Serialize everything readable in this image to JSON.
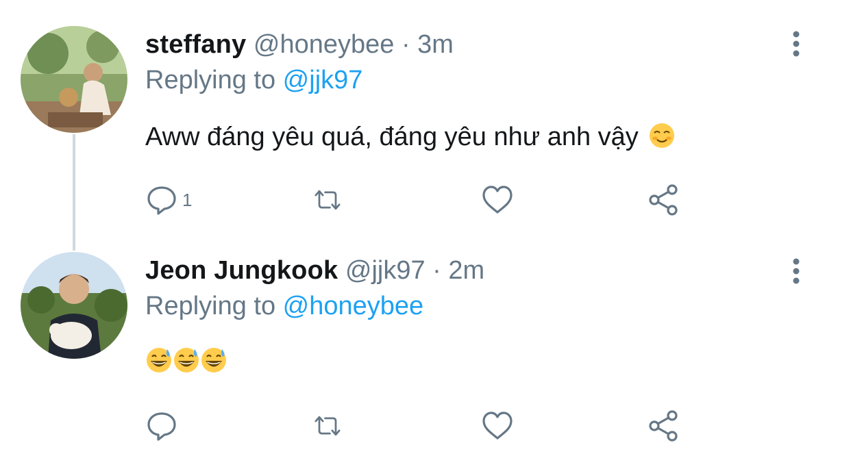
{
  "tweets": [
    {
      "name": "steffany",
      "handle": "@honeybee",
      "sep": " · ",
      "time": "3m",
      "replying_prefix": "Replying to ",
      "replying_to": "@jjk97",
      "text": "Aww đáng yêu quá, đáng yêu như anh vậy",
      "emojis": [
        "smiling-face-icon"
      ],
      "reply_count": "1",
      "icons": {
        "reply": "reply-icon",
        "retweet": "retweet-icon",
        "like": "heart-icon",
        "share": "share-icon",
        "more": "more-vertical-icon"
      }
    },
    {
      "name": "Jeon Jungkook",
      "handle": "@jjk97",
      "sep": " · ",
      "time": "2m",
      "replying_prefix": "Replying to ",
      "replying_to": "@honeybee",
      "text": "",
      "emojis": [
        "grinning-sweat-face-icon",
        "grinning-sweat-face-icon",
        "grinning-sweat-face-icon"
      ],
      "reply_count": "",
      "icons": {
        "reply": "reply-icon",
        "retweet": "retweet-icon",
        "like": "heart-icon",
        "share": "share-icon",
        "more": "more-vertical-icon"
      }
    }
  ],
  "colors": {
    "link": "#1da1f2",
    "muted": "#657786",
    "text": "#14171a",
    "thread_line": "#cfd9de"
  }
}
